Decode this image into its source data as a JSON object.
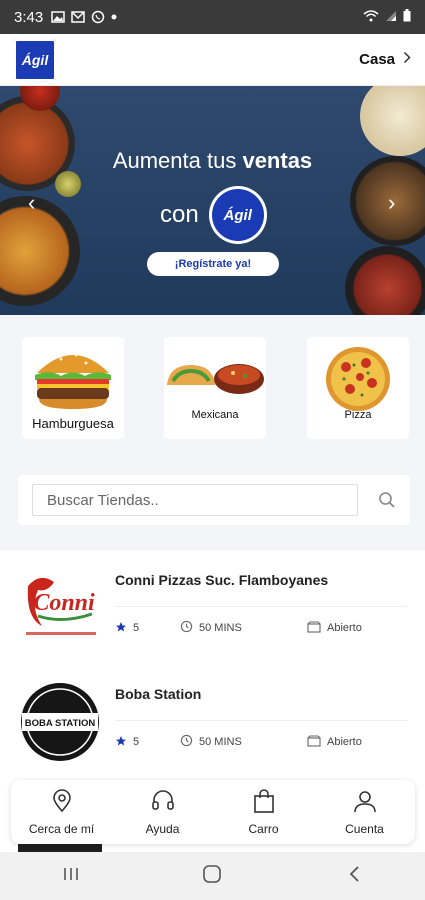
{
  "status_bar": {
    "time": "3:43"
  },
  "header": {
    "logo_text": "Ágil",
    "location_label": "Casa"
  },
  "banner": {
    "headline_prefix": "Aumenta tus ",
    "headline_bold": "ventas",
    "subline": "con",
    "logo_text": "Ágil",
    "cta_label": "¡Regístrate ya!"
  },
  "categories": [
    {
      "label": "Hamburguesa",
      "icon": "burger-icon"
    },
    {
      "label": "Mexicana",
      "icon": "taco-icon"
    },
    {
      "label": "Pizza",
      "icon": "pizza-icon"
    }
  ],
  "search": {
    "placeholder": "Buscar Tiendas.."
  },
  "stores": [
    {
      "name": "Conni Pizzas Suc. Flamboyanes",
      "rating": "5",
      "time": "50 MINS",
      "status": "Abierto",
      "logo_text": "Conni"
    },
    {
      "name": "Boba Station",
      "rating": "5",
      "time": "50 MINS",
      "status": "Abierto",
      "logo_text": "BOBA STATION"
    }
  ],
  "bottom_nav": [
    {
      "label": "Cerca de mí",
      "icon": "location-pin-icon"
    },
    {
      "label": "Ayuda",
      "icon": "headset-icon"
    },
    {
      "label": "Carro",
      "icon": "shopping-bag-icon"
    },
    {
      "label": "Cuenta",
      "icon": "user-icon"
    }
  ],
  "colors": {
    "brand": "#1a3bb3",
    "star": "#1a3bb3",
    "banner_bg": "#203a5c"
  }
}
